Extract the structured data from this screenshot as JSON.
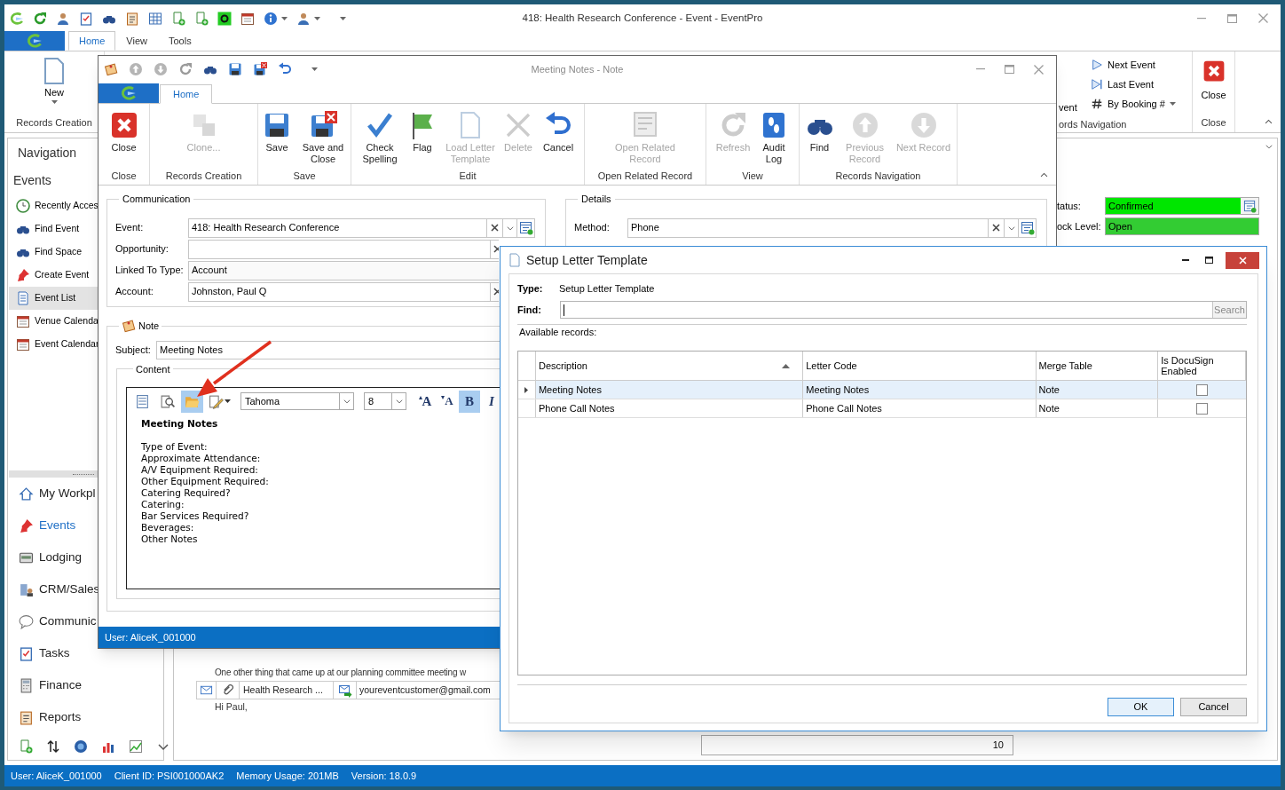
{
  "main_window": {
    "title": "418: Health Research Conference - Event - EventPro",
    "tabs": [
      {
        "label": "Home",
        "selected": true
      },
      {
        "label": "View",
        "selected": false
      },
      {
        "label": "Tools",
        "selected": false
      }
    ],
    "ribbon": {
      "new_button": "New",
      "new_group": "Records Creation",
      "cut_button": "vent",
      "nav_buttons": [
        "Next Event",
        "Last Event",
        "By Booking #"
      ],
      "nav_group": "ords Navigation",
      "close_button": "Close",
      "close_group": "Close"
    },
    "navigation": {
      "title": "Navigation",
      "section": "Events",
      "items": [
        {
          "label": "Recently Acces",
          "selected": false
        },
        {
          "label": "Find Event",
          "selected": false
        },
        {
          "label": "Find Space",
          "selected": false
        },
        {
          "label": "Create Event",
          "selected": false
        },
        {
          "label": "Event List",
          "selected": true
        },
        {
          "label": "Venue Calenda",
          "selected": false
        },
        {
          "label": "Event Calendar",
          "selected": false
        }
      ],
      "modules": [
        {
          "label": "My Workpl",
          "selected": false
        },
        {
          "label": "Events",
          "selected": true
        },
        {
          "label": "Lodging",
          "selected": false
        },
        {
          "label": "CRM/Sales",
          "selected": false
        },
        {
          "label": "Communic",
          "selected": false
        },
        {
          "label": "Tasks",
          "selected": false
        },
        {
          "label": "Finance",
          "selected": false
        },
        {
          "label": "Reports",
          "selected": false
        }
      ]
    },
    "status_fields": [
      {
        "label": "tatus:",
        "value": "Confirmed",
        "color": "#00e600"
      },
      {
        "label": "ock Level:",
        "value": "Open",
        "color": "#33cc33"
      }
    ],
    "email": {
      "line": "One other thing that came up at our planning committee meeting w",
      "subject": "Health Research ...",
      "address": "youreventcustomer@gmail.com",
      "greeting": "Hi Paul,"
    },
    "count_field": "10",
    "status_bar": [
      "User: AliceK_001000",
      "Client ID: PSI001000AK2",
      "Memory Usage: 201MB",
      "Version: 18.0.9"
    ]
  },
  "note_window": {
    "title": "Meeting Notes - Note",
    "tabs": [
      {
        "label": "Home",
        "selected": true
      }
    ],
    "ribbon_groups": [
      {
        "label": "Close",
        "buttons": [
          {
            "label": "Close",
            "disabled": false
          }
        ]
      },
      {
        "label": "Records Creation",
        "buttons": [
          {
            "label": "Clone...",
            "disabled": true
          }
        ]
      },
      {
        "label": "Save",
        "buttons": [
          {
            "label": "Save",
            "disabled": false
          },
          {
            "label": "Save and Close",
            "disabled": false
          }
        ]
      },
      {
        "label": "Edit",
        "buttons": [
          {
            "label": "Check Spelling",
            "disabled": false
          },
          {
            "label": "Flag",
            "disabled": false
          },
          {
            "label": "Load Letter Template",
            "disabled": true
          },
          {
            "label": "Delete",
            "disabled": true
          },
          {
            "label": "Cancel",
            "disabled": false
          }
        ]
      },
      {
        "label": "Open Related Record",
        "buttons": [
          {
            "label": "Open Related Record",
            "disabled": true
          }
        ]
      },
      {
        "label": "View",
        "buttons": [
          {
            "label": "Refresh",
            "disabled": true
          },
          {
            "label": "Audit Log",
            "disabled": false
          }
        ]
      },
      {
        "label": "Records Navigation",
        "buttons": [
          {
            "label": "Find",
            "disabled": false
          },
          {
            "label": "Previous Record",
            "disabled": true
          },
          {
            "label": "Next Record",
            "disabled": true
          }
        ]
      }
    ],
    "communication": {
      "title": "Communication",
      "fields": [
        {
          "label": "Event:",
          "value": "418: Health Research Conference",
          "kind": "lookup"
        },
        {
          "label": "Opportunity:",
          "kind": "lookup"
        },
        {
          "label": "Linked To Type:",
          "value": "Account",
          "kind": "text"
        },
        {
          "label": "Account:",
          "value": "Johnston, Paul Q",
          "kind": "lookup"
        }
      ]
    },
    "details": {
      "title": "Details",
      "fields": [
        {
          "label": "Method:",
          "value": "Phone",
          "kind": "lookup"
        }
      ]
    },
    "note": {
      "title": "Note",
      "subject_label": "Subject:",
      "subject": "Meeting Notes",
      "content_title": "Content",
      "toolbar": {
        "buttons": [
          {
            "selected": false
          },
          {
            "selected": false
          },
          {
            "selected": true
          },
          {
            "selected": false
          }
        ],
        "font": "Tahoma",
        "size": "8",
        "format_buttons": [
          {
            "label": "A",
            "selected": false
          },
          {
            "label": "A",
            "selected": false
          },
          {
            "label": "B",
            "selected": true
          },
          {
            "label": "I",
            "selected": false
          }
        ]
      },
      "heading": "Meeting Notes",
      "lines": [
        "Type of Event:",
        "Approximate Attendance:",
        "A/V Equipment Required:",
        "Other Equipment Required:",
        "Catering Required?",
        "Catering:",
        "Bar Services Required?",
        "Beverages:",
        "Other Notes"
      ]
    },
    "status_bar": "User: AliceK_001000"
  },
  "dialog": {
    "title": "Setup Letter Template",
    "type_label": "Type:",
    "type_value": "Setup Letter Template",
    "find_label": "Find:",
    "search_button": "Search",
    "available_label": "Available records:",
    "columns": [
      {
        "label": "Description",
        "sorted": true
      },
      {
        "label": "Letter Code",
        "sorted": false
      },
      {
        "label": "Merge Table",
        "sorted": false
      },
      {
        "label": "Is DocuSign Enabled",
        "sorted": false
      }
    ],
    "rows": [
      {
        "cells": [
          "Meeting Notes",
          "Meeting Notes",
          "Note"
        ],
        "docusign_enabled": false,
        "selected": true
      },
      {
        "cells": [
          "Phone Call Notes",
          "Phone Call Notes",
          "Note"
        ],
        "docusign_enabled": false,
        "selected": false
      }
    ],
    "buttons": [
      "OK",
      "Cancel"
    ]
  }
}
